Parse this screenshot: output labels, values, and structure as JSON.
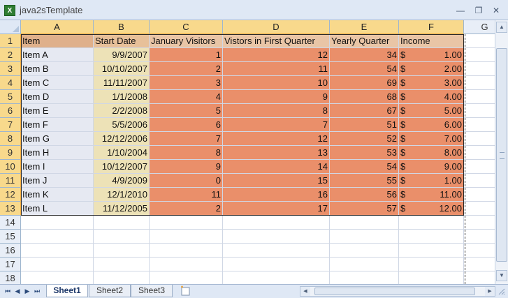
{
  "window": {
    "title": "java2sTemplate",
    "icon_name": "excel-icon",
    "icon_letter": "X"
  },
  "columns": [
    "A",
    "B",
    "C",
    "D",
    "E",
    "F",
    "G"
  ],
  "row_numbers": [
    "1",
    "2",
    "3",
    "4",
    "5",
    "6",
    "7",
    "8",
    "9",
    "10",
    "11",
    "12",
    "13",
    "14",
    "15",
    "16",
    "17",
    "18"
  ],
  "header_row": [
    "Item",
    "Start Date",
    "January Visitors",
    "Vistors in First Quarter",
    "Yearly Quarter",
    "Income"
  ],
  "currency_symbol": "$",
  "rows": [
    {
      "item": "Item A",
      "start": "9/9/2007",
      "jan": "1",
      "q1": "12",
      "yearly": "34",
      "income": "1.00"
    },
    {
      "item": "Item B",
      "start": "10/10/2007",
      "jan": "2",
      "q1": "11",
      "yearly": "54",
      "income": "2.00"
    },
    {
      "item": "Item C",
      "start": "11/11/2007",
      "jan": "3",
      "q1": "10",
      "yearly": "69",
      "income": "3.00"
    },
    {
      "item": "Item D",
      "start": "1/1/2008",
      "jan": "4",
      "q1": "9",
      "yearly": "68",
      "income": "4.00"
    },
    {
      "item": "Item E",
      "start": "2/2/2008",
      "jan": "5",
      "q1": "8",
      "yearly": "67",
      "income": "5.00"
    },
    {
      "item": "Item F",
      "start": "5/5/2006",
      "jan": "6",
      "q1": "7",
      "yearly": "51",
      "income": "6.00"
    },
    {
      "item": "Item G",
      "start": "12/12/2006",
      "jan": "7",
      "q1": "12",
      "yearly": "52",
      "income": "7.00"
    },
    {
      "item": "Item H",
      "start": "1/10/2004",
      "jan": "8",
      "q1": "13",
      "yearly": "53",
      "income": "8.00"
    },
    {
      "item": "Item I",
      "start": "10/12/2007",
      "jan": "9",
      "q1": "14",
      "yearly": "54",
      "income": "9.00"
    },
    {
      "item": "Item J",
      "start": "4/9/2009",
      "jan": "0",
      "q1": "15",
      "yearly": "55",
      "income": "1.00"
    },
    {
      "item": "Item K",
      "start": "12/1/2010",
      "jan": "11",
      "q1": "16",
      "yearly": "56",
      "income": "11.00"
    },
    {
      "item": "Item L",
      "start": "11/12/2005",
      "jan": "2",
      "q1": "17",
      "yearly": "57",
      "income": "12.00"
    }
  ],
  "sheet_tabs": [
    {
      "label": "Sheet1",
      "active": true
    },
    {
      "label": "Sheet2",
      "active": false
    },
    {
      "label": "Sheet3",
      "active": false
    }
  ],
  "selection": {
    "range": "A1:F13",
    "selected_columns": [
      "A",
      "B",
      "C",
      "D",
      "E",
      "F"
    ]
  },
  "colors": {
    "column_a_fill": "#e6e9f2",
    "column_b_fill": "#ede2b7",
    "data_fill": "#ea8f6a",
    "header_highlight": "#f8d98c"
  }
}
